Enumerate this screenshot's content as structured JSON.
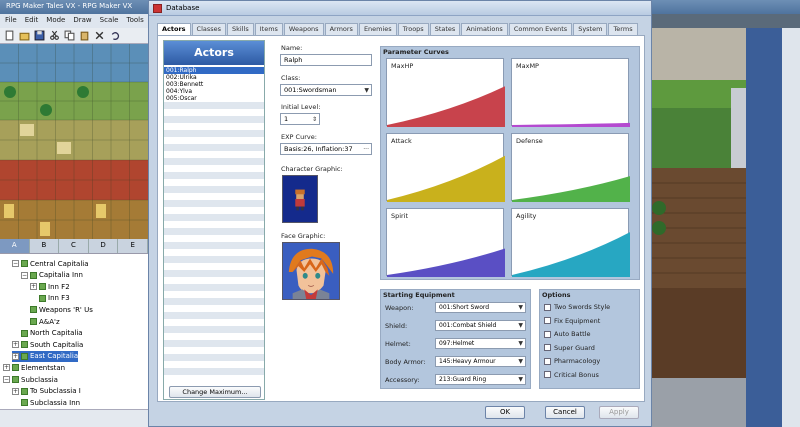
{
  "main_window": {
    "title": "RPG Maker Tales VX - RPG Maker VX",
    "menu": [
      "File",
      "Edit",
      "Mode",
      "Draw",
      "Scale",
      "Tools"
    ],
    "tile_tabs": [
      "A",
      "B",
      "C",
      "D",
      "E"
    ],
    "active_tile_tab": "A"
  },
  "map_tree": [
    {
      "label": "Central Capitalia",
      "indent": 1,
      "expander": "−"
    },
    {
      "label": "Capitalia Inn",
      "indent": 2,
      "expander": "−"
    },
    {
      "label": "Inn F2",
      "indent": 3,
      "expander": "+"
    },
    {
      "label": "Inn F3",
      "indent": 3,
      "expander": ""
    },
    {
      "label": "Weapons 'R' Us",
      "indent": 2,
      "expander": ""
    },
    {
      "label": "A&A'z",
      "indent": 2,
      "expander": ""
    },
    {
      "label": "North Capitalia",
      "indent": 1,
      "expander": ""
    },
    {
      "label": "South Capitalia",
      "indent": 1,
      "expander": "+"
    },
    {
      "label": "East Capitalia",
      "indent": 1,
      "expander": "+",
      "selected": true
    },
    {
      "label": "Elementstan",
      "indent": 0,
      "expander": "+"
    },
    {
      "label": "Subclassia",
      "indent": 0,
      "expander": "−"
    },
    {
      "label": "To Subclassia I",
      "indent": 1,
      "expander": "+"
    },
    {
      "label": "Subclassia Inn",
      "indent": 1,
      "expander": ""
    }
  ],
  "database": {
    "title": "Database",
    "tabs": [
      "Actors",
      "Classes",
      "Skills",
      "Items",
      "Weapons",
      "Armors",
      "Enemies",
      "Troops",
      "States",
      "Animations",
      "Common Events",
      "System",
      "Terms"
    ],
    "active_tab": "Actors",
    "actors_header": "Actors",
    "actors": [
      "001:Ralph",
      "002:Ulrika",
      "003:Bennett",
      "004:Ylva",
      "005:Oscar"
    ],
    "selected_actor": "001:Ralph",
    "change_max_label": "Change Maximum...",
    "fields": {
      "name_label": "Name:",
      "name_value": "Ralph",
      "class_label": "Class:",
      "class_value": "001:Swordsman",
      "level_label": "Initial Level:",
      "level_value": "1",
      "exp_label": "EXP Curve:",
      "exp_value": "Basis:26, Inflation:37",
      "char_graphic_label": "Character Graphic:",
      "face_graphic_label": "Face Graphic:"
    },
    "parameter_curves": {
      "title": "Parameter Curves",
      "curves": [
        {
          "label": "MaxHP",
          "color": "#c8434c",
          "end": 0.6
        },
        {
          "label": "MaxMP",
          "color": "#b44ad0",
          "end": 0.06
        },
        {
          "label": "Attack",
          "color": "#c9b11c",
          "end": 0.68
        },
        {
          "label": "Defense",
          "color": "#52b24a",
          "end": 0.38
        },
        {
          "label": "Spirit",
          "color": "#5a4fc4",
          "end": 0.42
        },
        {
          "label": "Agility",
          "color": "#27a7c2",
          "end": 0.66
        }
      ]
    },
    "equipment": {
      "title": "Starting Equipment",
      "rows": [
        {
          "label": "Weapon:",
          "value": "001:Short Sword"
        },
        {
          "label": "Shield:",
          "value": "001:Combat Shield"
        },
        {
          "label": "Helmet:",
          "value": "097:Helmet"
        },
        {
          "label": "Body Armor:",
          "value": "145:Heavy Armour"
        },
        {
          "label": "Accessory:",
          "value": "213:Guard Ring"
        }
      ]
    },
    "options": {
      "title": "Options",
      "items": [
        "Two Swords Style",
        "Fix Equipment",
        "Auto Battle",
        "Super Guard",
        "Pharmacology",
        "Critical Bonus"
      ]
    },
    "buttons": {
      "ok": "OK",
      "cancel": "Cancel",
      "apply": "Apply"
    }
  }
}
